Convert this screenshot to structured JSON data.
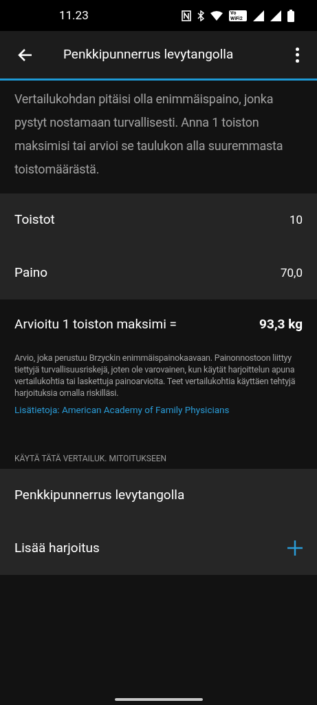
{
  "status_bar": {
    "time": "11.23",
    "wifi_calling_badge": "Vo WiFi2"
  },
  "app_bar": {
    "title": "Penkkipunnerrus levytangolla"
  },
  "intro": "Vertailukohdan pitäisi olla enimmäispaino, jonka pystyt nostamaan turvallisesti. Anna 1 toiston maksimisi tai arvioi se taulukon alla suuremmasta toistomäärästä.",
  "inputs": [
    {
      "label": "Toistot",
      "value": "10"
    },
    {
      "label": "Paino",
      "value": "70,0"
    }
  ],
  "estimate": {
    "label": "Arvioitu 1 toiston maksimi =",
    "value": "93,3 kg"
  },
  "disclaimer": "Arvio, joka perustuu Brzyckin enimmäispainokaavaan. Painonnostoon liittyy tiettyjä turvallisuusriskejä, joten ole varovainen, kun käytät harjoittelun apuna vertailukohtia tai laskettuja painoarvioita. Teet vertailukohtia käyttäen tehtyjä harjoituksia omalla riskilläsi.",
  "link": "Lisätietoja: American Academy of Family Physicians",
  "section_header": "KÄYTÄ TÄTÄ VERTAILUK. MITOITUKSEEN",
  "exercises": [
    {
      "kind": "exercise",
      "label": "Penkkipunnerrus levytangolla"
    },
    {
      "kind": "add",
      "label": "Lisää harjoitus"
    }
  ]
}
